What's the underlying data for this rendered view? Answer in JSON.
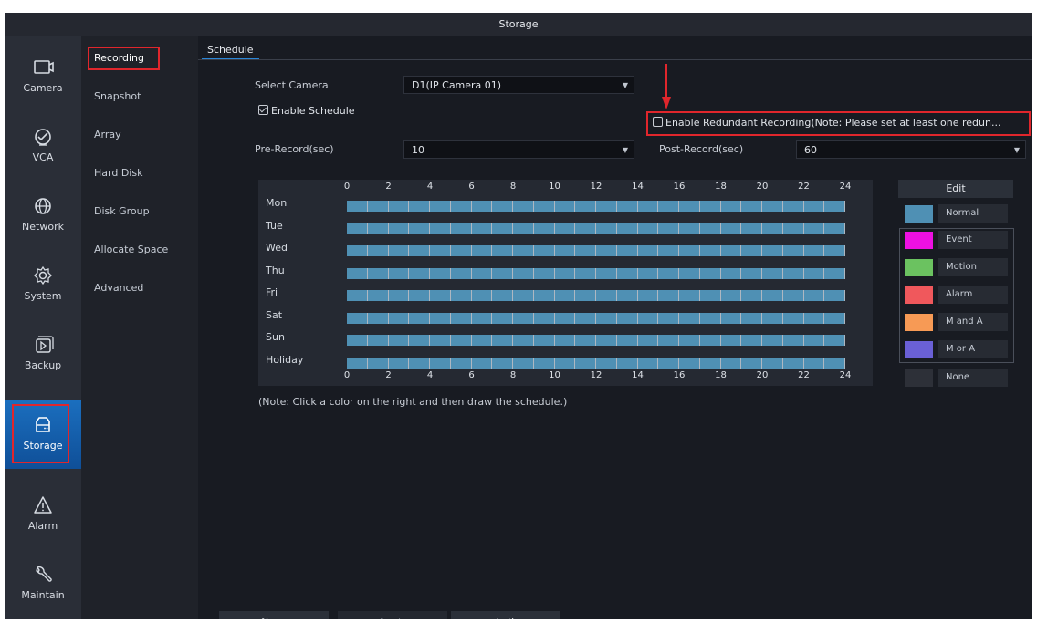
{
  "window": {
    "title": "Storage"
  },
  "nav": [
    {
      "label": "Camera",
      "icon": "camera-icon"
    },
    {
      "label": "VCA",
      "icon": "vca-icon"
    },
    {
      "label": "Network",
      "icon": "globe-icon"
    },
    {
      "label": "System",
      "icon": "gear-icon"
    },
    {
      "label": "Backup",
      "icon": "backup-icon"
    },
    {
      "label": "Storage",
      "icon": "storage-icon",
      "active": true
    },
    {
      "label": "Alarm",
      "icon": "warning-icon"
    },
    {
      "label": "Maintain",
      "icon": "wrench-icon"
    }
  ],
  "submenu": [
    "Recording",
    "Snapshot",
    "Array",
    "Hard Disk",
    "Disk Group",
    "Allocate Space",
    "Advanced"
  ],
  "tab": "Schedule",
  "form": {
    "select_camera_label": "Select Camera",
    "select_camera_value": "D1(IP Camera 01)",
    "enable_schedule_label": "Enable Schedule",
    "enable_schedule_checked": true,
    "redundant_label": "Enable Redundant Recording(Note: Please set at least one redun...",
    "redundant_checked": false,
    "pre_record_label": "Pre-Record(sec)",
    "pre_record_value": "10",
    "post_record_label": "Post-Record(sec)",
    "post_record_value": "60"
  },
  "schedule": {
    "hours": [
      "0",
      "2",
      "4",
      "6",
      "8",
      "10",
      "12",
      "14",
      "16",
      "18",
      "20",
      "22",
      "24"
    ],
    "days": [
      "Mon",
      "Tue",
      "Wed",
      "Thu",
      "Fri",
      "Sat",
      "Sun",
      "Holiday"
    ],
    "fill_color": "#4f90b4",
    "note": "(Note: Click a color on the right and then draw the schedule.)"
  },
  "legend": {
    "edit_label": "Edit",
    "items": [
      {
        "name": "Normal",
        "color": "#4f90b4"
      },
      {
        "name": "Event",
        "color": "#ee10e2"
      },
      {
        "name": "Motion",
        "color": "#6bc260"
      },
      {
        "name": "Alarm",
        "color": "#f0585c"
      },
      {
        "name": "M and A",
        "color": "#f79a55"
      },
      {
        "name": "M or A",
        "color": "#6a60d6"
      },
      {
        "name": "None",
        "color": "#2d3038"
      }
    ]
  },
  "buttons": {
    "copy": "Copy",
    "apply": "Apply",
    "exit": "Exit"
  },
  "colors": {
    "highlight": "#e0262c",
    "accent": "#1b6fbf"
  }
}
